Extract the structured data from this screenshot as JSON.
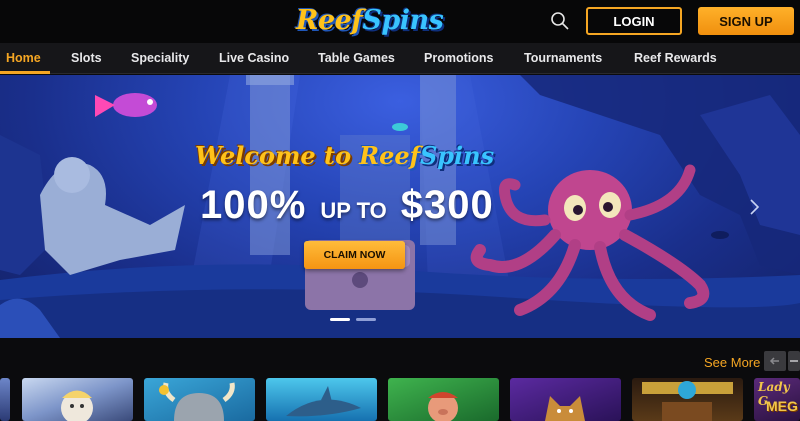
{
  "header": {
    "logo": {
      "part_a": "Reef",
      "part_b": "Spins"
    },
    "login_label": "LOGIN",
    "signup_label": "SIGN UP",
    "icon": "search-icon"
  },
  "nav": {
    "items": [
      {
        "label": "Home",
        "active": true
      },
      {
        "label": "Slots"
      },
      {
        "label": "Speciality"
      },
      {
        "label": "Live Casino"
      },
      {
        "label": "Table Games"
      },
      {
        "label": "Promotions"
      },
      {
        "label": "Tournaments"
      },
      {
        "label": "Reef Rewards"
      }
    ]
  },
  "hero": {
    "welcome_prefix": "Welcome to",
    "brand_a": "Reef",
    "brand_b": "Spins",
    "offer_percent": "100%",
    "offer_mid": "UP TO",
    "offer_amount": "$300",
    "cta_label": "CLAIM NOW",
    "slides_total": 2,
    "active_slide": 1
  },
  "games": {
    "see_more_label": "See More",
    "tiles": [
      {
        "name": "zeus-game"
      },
      {
        "name": "viking-game"
      },
      {
        "name": "shark-game"
      },
      {
        "name": "pig-game"
      },
      {
        "name": "wolf-game"
      },
      {
        "name": "scarab-game"
      },
      {
        "name": "lady-gold-game",
        "text_a": "Lady G",
        "text_b": "MEG"
      }
    ]
  },
  "colors": {
    "accent": "#f5a623",
    "nav_bg": "#161619",
    "header_bg": "#070708",
    "hero_blue": "#2544b5"
  }
}
